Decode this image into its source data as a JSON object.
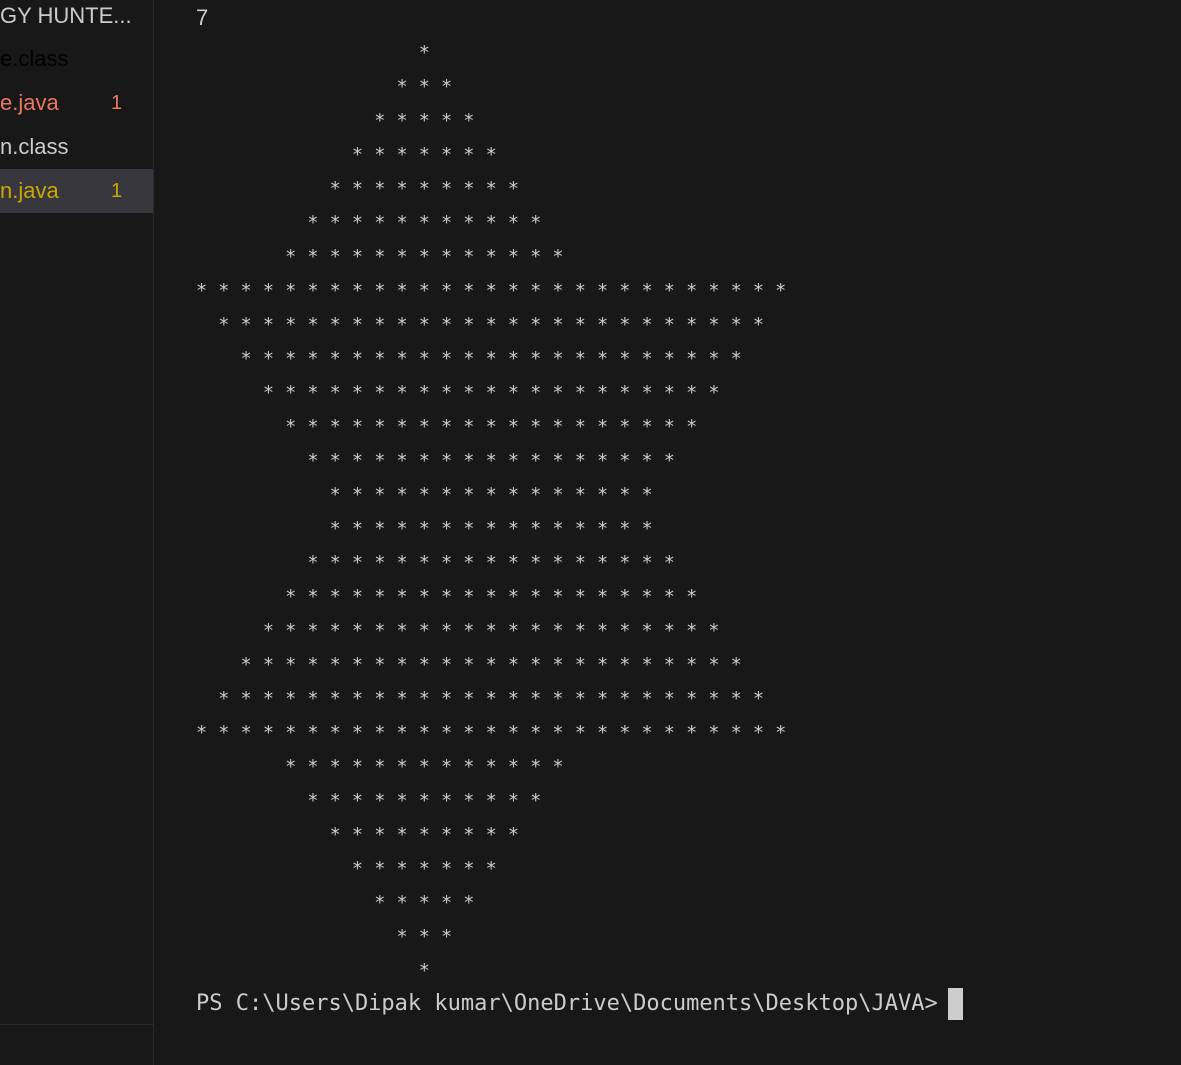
{
  "explorer": {
    "section_title": "GY HUNTE...",
    "files": [
      {
        "name": "e.class",
        "badge": "",
        "color": "#cccccc",
        "selected": false
      },
      {
        "name": "e.java",
        "badge": "1",
        "color": "#e8785f",
        "selected": false
      },
      {
        "name": "n.class",
        "badge": "",
        "color": "#cccccc",
        "selected": false
      },
      {
        "name": "n.java",
        "badge": "1",
        "color": "#cca700",
        "selected": true
      }
    ]
  },
  "terminal": {
    "input_echo": "7",
    "pattern_lines": [
      "                    *",
      "                  * * *",
      "                * * * * *",
      "              * * * * * * *",
      "            * * * * * * * * *",
      "          * * * * * * * * * * *",
      "        * * * * * * * * * * * * *",
      "* * * * * * * * * * * * * * * * * * * * * * * * * * *",
      "  * * * * * * * * * * * * * * * * * * * * * * * * *",
      "    * * * * * * * * * * * * * * * * * * * * * * *",
      "      * * * * * * * * * * * * * * * * * * * * *",
      "        * * * * * * * * * * * * * * * * * * *",
      "          * * * * * * * * * * * * * * * * *",
      "            * * * * * * * * * * * * * * *",
      "            * * * * * * * * * * * * * * *",
      "          * * * * * * * * * * * * * * * * *",
      "        * * * * * * * * * * * * * * * * * * *",
      "      * * * * * * * * * * * * * * * * * * * * *",
      "    * * * * * * * * * * * * * * * * * * * * * * *",
      "  * * * * * * * * * * * * * * * * * * * * * * * * *",
      "* * * * * * * * * * * * * * * * * * * * * * * * * * *",
      "        * * * * * * * * * * * * *",
      "          * * * * * * * * * * *",
      "            * * * * * * * * *",
      "              * * * * * * *",
      "                * * * * *",
      "                  * * *",
      "                    *"
    ],
    "prompt": "PS C:\\Users\\Dipak kumar\\OneDrive\\Documents\\Desktop\\JAVA>"
  },
  "colors": {
    "background": "#181818",
    "text": "#cccccc",
    "error_file": "#e8785f",
    "warning_file": "#cca700",
    "selected_row": "#37373d"
  }
}
